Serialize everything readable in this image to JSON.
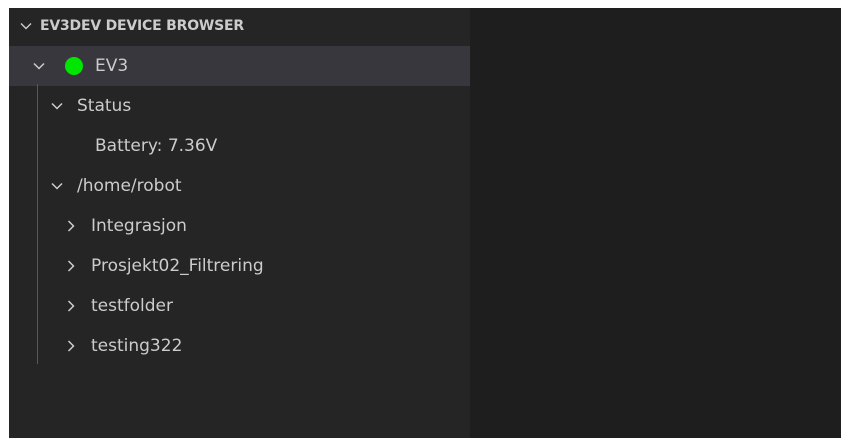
{
  "panel": {
    "title": "EV3DEV DEVICE BROWSER",
    "tree": {
      "device": {
        "label": "EV3",
        "status_color": "#00e600",
        "expanded": true,
        "icon": "chevron-down-icon"
      },
      "status": {
        "label": "Status",
        "expanded": true,
        "items": [
          {
            "label": "Battery: 7.36V"
          }
        ]
      },
      "home": {
        "label": "/home/robot",
        "expanded": true,
        "folders": [
          {
            "label": "Integrasjon",
            "expanded": false
          },
          {
            "label": "Prosjekt02_Filtrering",
            "expanded": false
          },
          {
            "label": "testfolder",
            "expanded": false
          },
          {
            "label": "testing322",
            "expanded": false
          }
        ]
      }
    }
  },
  "colors": {
    "sidebar_bg": "#252526",
    "editor_bg": "#1e1e1e",
    "selected_row": "#37373d",
    "text": "#cccccc",
    "status_green": "#00e600"
  }
}
